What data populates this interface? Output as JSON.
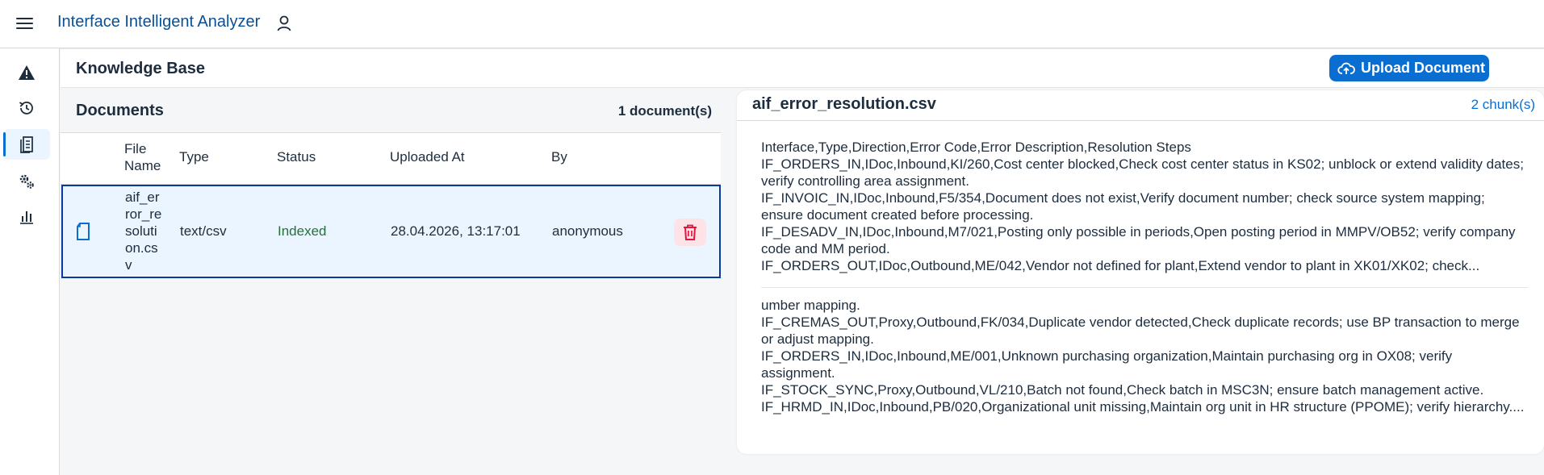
{
  "app": {
    "title": "Interface Intelligent Analyzer"
  },
  "sidenav": {
    "items": [
      {
        "icon": "warning-icon",
        "active": false
      },
      {
        "icon": "history-icon",
        "active": false
      },
      {
        "icon": "documents-icon",
        "active": true
      },
      {
        "icon": "settings-icon",
        "active": false
      },
      {
        "icon": "chart-icon",
        "active": false
      }
    ]
  },
  "page": {
    "title": "Knowledge Base",
    "upload_label": "Upload Document"
  },
  "documents": {
    "title": "Documents",
    "count_label": "1 document(s)",
    "columns": [
      "File Name",
      "Type",
      "Status",
      "Uploaded At",
      "By"
    ],
    "rows": [
      {
        "file_name": "aif_er\nror_re\nsoluti\non.cs\nv",
        "type": "text/csv",
        "status": "Indexed",
        "uploaded_at": "28.04.2026, 13:17:01",
        "by": "anonymous"
      }
    ]
  },
  "chunks": {
    "file_name": "aif_error_resolution.csv",
    "count_label": "2 chunk(s)",
    "items": [
      "Interface,Type,Direction,Error Code,Error Description,Resolution Steps\nIF_ORDERS_IN,IDoc,Inbound,KI/260,Cost center blocked,Check cost center status in KS02; unblock or extend validity dates; verify controlling area assignment.\nIF_INVOIC_IN,IDoc,Inbound,F5/354,Document does not exist,Verify document number; check source system mapping; ensure document created before processing.\nIF_DESADV_IN,IDoc,Inbound,M7/021,Posting only possible in periods,Open posting period in MMPV/OB52; verify company code and MM period.\nIF_ORDERS_OUT,IDoc,Outbound,ME/042,Vendor not defined for plant,Extend vendor to plant in XK01/XK02; check...",
      "umber mapping.\nIF_CREMAS_OUT,Proxy,Outbound,FK/034,Duplicate vendor detected,Check duplicate records; use BP transaction to merge or adjust mapping.\nIF_ORDERS_IN,IDoc,Inbound,ME/001,Unknown purchasing organization,Maintain purchasing org in OX08; verify assignment.\nIF_STOCK_SYNC,Proxy,Outbound,VL/210,Batch not found,Check batch in MSC3N; ensure batch management active.\nIF_HRMD_IN,IDoc,Inbound,PB/020,Organizational unit missing,Maintain org unit in HR structure (PPOME); verify hierarchy...."
    ]
  },
  "colors": {
    "accent": "#0a6ed1",
    "title": "#0a4f96",
    "status_ok": "#256f3a",
    "danger": "#e3163f",
    "selected_row": "#ebf5ff"
  }
}
